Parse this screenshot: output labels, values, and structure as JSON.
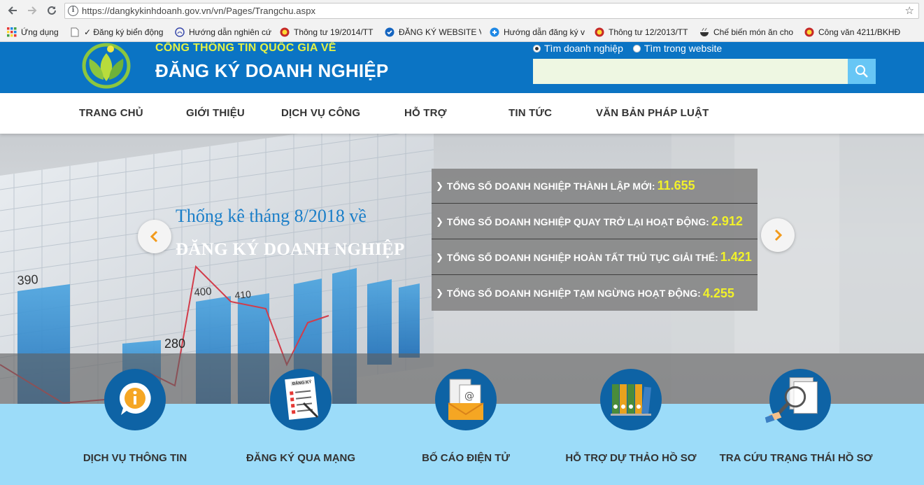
{
  "browser": {
    "url": "https://dangkykinhdoanh.gov.vn/vn/Pages/Trangchu.aspx",
    "bookmarks": [
      {
        "label": "Ứng dụng",
        "icon": "apps-grid-icon"
      },
      {
        "label": "✓ Đăng ký biển động",
        "icon": "page-icon"
      },
      {
        "label": "Hướng dẫn nghiên cứ",
        "icon": "hands-icon"
      },
      {
        "label": "Thông tư 19/2014/TT",
        "icon": "emblem-icon"
      },
      {
        "label": "ĐĂNG KÝ WEBSITE V",
        "icon": "check-badge-icon"
      },
      {
        "label": "Hướng dẫn đăng ký v",
        "icon": "plus-circle-icon"
      },
      {
        "label": "Thông tư 12/2013/TT",
        "icon": "emblem-icon"
      },
      {
        "label": "Chế biến món ăn cho",
        "icon": "bowl-icon"
      },
      {
        "label": "Công văn 4211/BKHĐ",
        "icon": "emblem-icon"
      }
    ]
  },
  "header": {
    "portal_title": "CỔNG THÔNG TIN QUỐC GIA VỀ",
    "site_title": "ĐĂNG KÝ DOANH NGHIỆP",
    "search_options": [
      "Tìm doanh nghiệp",
      "Tìm trong website"
    ],
    "selected_search_option": "Tìm doanh nghiệp",
    "search_value": "",
    "accent_color": "#0b74c4",
    "portal_title_color": "#e6f245"
  },
  "nav": [
    "TRANG CHỦ",
    "GIỚI THIỆU",
    "DỊCH VỤ CÔNG",
    "HỖ TRỢ",
    "TIN TỨC",
    "VĂN BẢN PHÁP LUẬT"
  ],
  "hero": {
    "heading": "Thống kê tháng 8/2018 về",
    "subheading": "ĐĂNG KÝ DOANH NGHIỆP",
    "background_chart_labels": [
      "390",
      "280",
      "400",
      "410"
    ],
    "stats": [
      {
        "label": "TỔNG SỐ DOANH NGHIỆP THÀNH LẬP MỚI:",
        "value": "11.655"
      },
      {
        "label": "TỔNG SỐ DOANH NGHIỆP QUAY TRỞ LẠI HOẠT ĐỘNG:",
        "value": "2.912"
      },
      {
        "label": "TỔNG SỐ DOANH NGHIỆP HOÀN TẤT THỦ TỤC GIẢI THỂ:",
        "value": "1.421"
      },
      {
        "label": "TỔNG SỐ DOANH NGHIỆP TẠM NGỪNG HOẠT ĐỘNG:",
        "value": "4.255"
      }
    ],
    "stat_value_color": "#f1f12a",
    "arrow_color": "#f29a1b"
  },
  "services": [
    {
      "label": "DỊCH VỤ THÔNG TIN",
      "icon": "info-bubble-icon"
    },
    {
      "label": "ĐĂNG KÝ QUA MẠNG",
      "icon": "registration-form-icon",
      "icon_text": "ĐĂNG KÝ"
    },
    {
      "label": "BỐ CÁO ĐIỆN TỬ",
      "icon": "email-envelope-icon"
    },
    {
      "label": "HỖ TRỢ DỰ THẢO HỒ SƠ",
      "icon": "binders-icon"
    },
    {
      "label": "TRA CỨU TRẠNG THÁI HỒ SƠ",
      "icon": "magnifier-documents-icon"
    }
  ]
}
